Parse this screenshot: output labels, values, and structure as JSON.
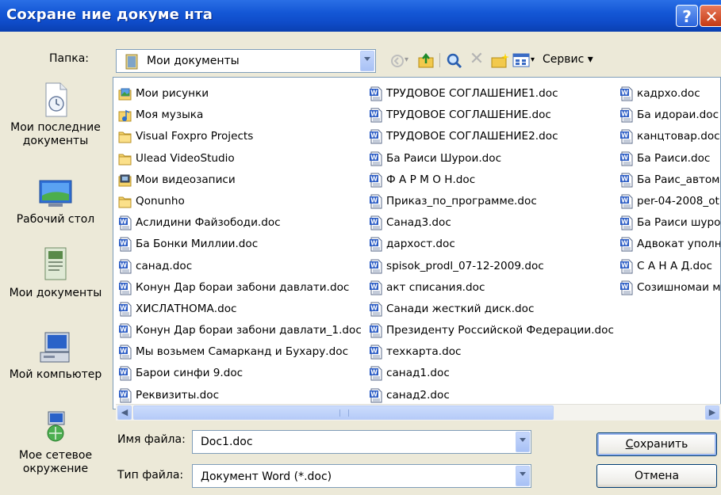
{
  "window": {
    "title": "Сохране ние докуме нта",
    "help_label": "?",
    "close_label": "✕"
  },
  "folder": {
    "label": "Папка:",
    "value": "Мои документы",
    "icon": "folder-docs-icon"
  },
  "toolbar": {
    "service_label": "Сервис ▾"
  },
  "places": [
    {
      "id": "recent",
      "label": "Мои последние документы",
      "icon": "recent-docs-icon"
    },
    {
      "id": "desktop",
      "label": "Рабочий стол",
      "icon": "desktop-icon"
    },
    {
      "id": "mydocs",
      "label": "Мои документы",
      "icon": "my-documents-icon"
    },
    {
      "id": "mycomputer",
      "label": "Мой компьютер",
      "icon": "my-computer-icon"
    },
    {
      "id": "network",
      "label": "Мое сетевое окружение",
      "icon": "network-icon"
    }
  ],
  "files": {
    "col1": [
      {
        "name": "Мои рисунки",
        "icon": "pictures-folder-icon"
      },
      {
        "name": "Моя музыка",
        "icon": "music-folder-icon"
      },
      {
        "name": "Visual Foxpro Projects",
        "icon": "folder-icon"
      },
      {
        "name": "Ulead VideoStudio",
        "icon": "folder-icon"
      },
      {
        "name": "Мои видеозаписи",
        "icon": "video-folder-icon"
      },
      {
        "name": "Qonunho",
        "icon": "folder-icon"
      },
      {
        "name": "Аслидини Файзободи.doc",
        "icon": "word-doc-icon"
      },
      {
        "name": "Ба Бонки Миллии.doc",
        "icon": "word-doc-icon"
      },
      {
        "name": "санад.doc",
        "icon": "word-doc-icon"
      },
      {
        "name": "Конун Дар бораи забони давлати.doc",
        "icon": "word-doc-icon"
      },
      {
        "name": "ХИСЛАТНОМА.doc",
        "icon": "word-doc-icon"
      },
      {
        "name": "Конун Дар бораи забони давлати_1.doc",
        "icon": "word-doc-icon"
      },
      {
        "name": "Мы возьмем Самарканд и Бухару.doc",
        "icon": "word-doc-icon"
      },
      {
        "name": "Барои синфи 9.doc",
        "icon": "word-doc-icon"
      },
      {
        "name": "Реквизиты.doc",
        "icon": "word-doc-icon"
      }
    ],
    "col2": [
      {
        "name": "ТРУДОВОЕ  СОГЛАШЕНИЕ1.doc",
        "icon": "word-doc-icon"
      },
      {
        "name": "ТРУДОВОЕ  СОГЛАШЕНИЕ.doc",
        "icon": "word-doc-icon"
      },
      {
        "name": "ТРУДОВОЕ  СОГЛАШЕНИЕ2.doc",
        "icon": "word-doc-icon"
      },
      {
        "name": "Ба Раиси Шурои.doc",
        "icon": "word-doc-icon"
      },
      {
        "name": "Ф А Р М О Н.doc",
        "icon": "word-doc-icon"
      },
      {
        "name": "Приказ_по_программе.doc",
        "icon": "word-doc-icon"
      },
      {
        "name": "Санад3.doc",
        "icon": "word-doc-icon"
      },
      {
        "name": "дархост.doc",
        "icon": "word-doc-icon"
      },
      {
        "name": "spisok_prodl_07-12-2009.doc",
        "icon": "word-doc-icon"
      },
      {
        "name": "акт списания.doc",
        "icon": "word-doc-icon"
      },
      {
        "name": "Санади жесткий диск.doc",
        "icon": "word-doc-icon"
      },
      {
        "name": "Президенту Российской Федерации.doc",
        "icon": "word-doc-icon"
      },
      {
        "name": "техкарта.doc",
        "icon": "word-doc-icon"
      },
      {
        "name": "санад1.doc",
        "icon": "word-doc-icon"
      },
      {
        "name": "санад2.doc",
        "icon": "word-doc-icon"
      }
    ],
    "col3": [
      {
        "name": "кадрхо.doc",
        "icon": "word-doc-icon"
      },
      {
        "name": "Ба идораи.doc",
        "icon": "word-doc-icon"
      },
      {
        "name": "канцтовар.doc",
        "icon": "word-doc-icon"
      },
      {
        "name": "Ба Раиси.doc",
        "icon": "word-doc-icon"
      },
      {
        "name": "Ба Раис_автом",
        "icon": "word-doc-icon"
      },
      {
        "name": "per-04-2008_ot",
        "icon": "word-doc-icon"
      },
      {
        "name": "Ба Раиси шуро",
        "icon": "word-doc-icon"
      },
      {
        "name": "Адвокат уполн",
        "icon": "word-doc-icon"
      },
      {
        "name": "С А Н А Д.doc",
        "icon": "word-doc-icon"
      },
      {
        "name": "Созишномаи ме",
        "icon": "word-doc-icon"
      }
    ]
  },
  "filename": {
    "label": "Имя файла:",
    "value": "Doc1.doc"
  },
  "filetype": {
    "label": "Тип файла:",
    "value": "Документ Word (*.doc)"
  },
  "buttons": {
    "save_hotkey": "С",
    "save_rest": "охранить",
    "cancel": "Отмена"
  },
  "colors": {
    "titlebar": "#0f4cc9",
    "dialog_bg": "#ece9d8",
    "border": "#7f9db9"
  }
}
